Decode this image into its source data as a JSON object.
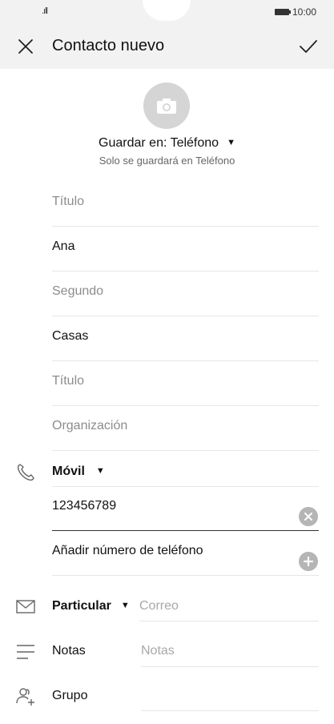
{
  "status": {
    "signal": ".ıll",
    "time": "10:00"
  },
  "header": {
    "title": "Contacto nuevo"
  },
  "photo": {
    "icon": "camera-icon"
  },
  "save": {
    "label": "Guardar en: Teléfono",
    "note": "Solo se guardará en Teléfono"
  },
  "fields": {
    "prefix_placeholder": "Título",
    "first_name": "Ana",
    "middle_placeholder": "Segundo",
    "last_name": "Casas",
    "suffix_placeholder": "Título",
    "org_placeholder": "Organización"
  },
  "phone": {
    "type": "Móvil",
    "number": "123456789",
    "add_label": "Añadir número de teléfono"
  },
  "email": {
    "type": "Particular",
    "placeholder": "Correo"
  },
  "notes": {
    "label": "Notas",
    "placeholder": "Notas"
  },
  "group": {
    "label": "Grupo"
  },
  "colors": {
    "bar_bg": "#f2f2f2",
    "circle": "#b5b5b5",
    "photo": "#d5d5d5"
  }
}
